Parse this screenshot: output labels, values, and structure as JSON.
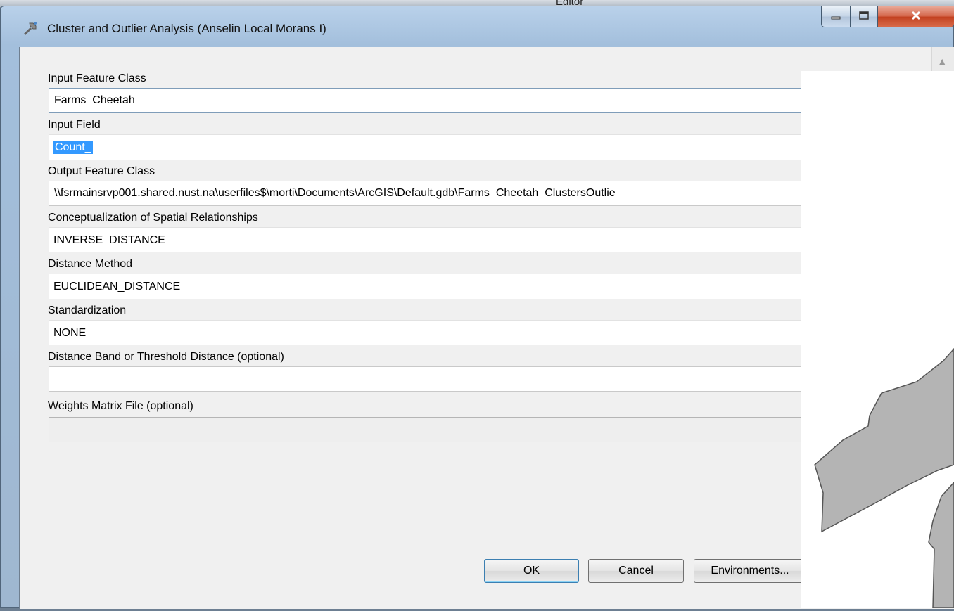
{
  "background_app": {
    "toolbar_label": "Editor"
  },
  "window": {
    "title": "Cluster and Outlier Analysis (Anselin Local Morans I)",
    "controls": [
      "minimize",
      "maximize",
      "close"
    ]
  },
  "params": [
    {
      "label": "Input Feature Class",
      "value": "Farms_Cheetah"
    },
    {
      "label": "Input Field",
      "value": "Count_"
    },
    {
      "label": "Output Feature Class",
      "value": "\\\\fsrmainsrvp001.shared.nust.na\\userfiles$\\morti\\Documents\\ArcGIS\\Default.gdb\\Farms_Cheetah_ClustersOutlie"
    },
    {
      "label": "Conceptualization of Spatial Relationships",
      "value": "INVERSE_DISTANCE"
    },
    {
      "label": "Distance Method",
      "value": "EUCLIDEAN_DISTANCE"
    },
    {
      "label": "Standardization",
      "value": "NONE"
    },
    {
      "label": "Distance Band or Threshold Distance (optional)",
      "value": ""
    },
    {
      "label": "Weights Matrix File (optional)",
      "value": ""
    }
  ],
  "buttons": {
    "ok": "OK",
    "cancel": "Cancel",
    "environments": "Environments..."
  },
  "colors": {
    "title_gradient_top": "#b9d1ea",
    "close_button": "#c2401f",
    "selection_highlight": "#3399ff",
    "map_polygon_fill": "#b4b4b4"
  }
}
